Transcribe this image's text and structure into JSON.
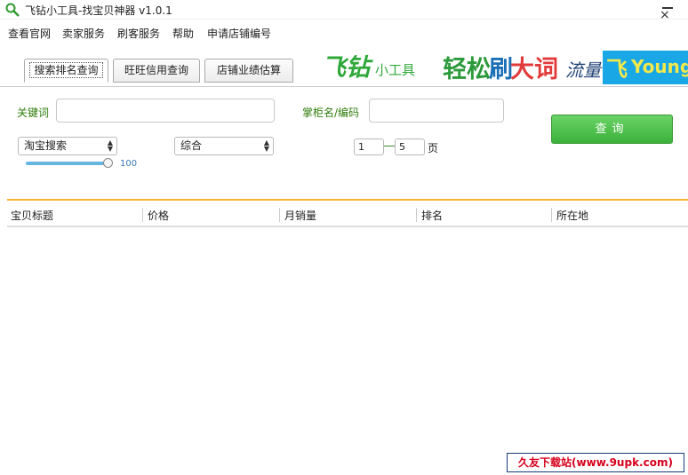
{
  "window": {
    "title": "飞钻小工具-找宝贝神器 v1.0.1",
    "close_glyph": "×"
  },
  "menu": [
    "查看官网",
    "卖家服务",
    "刷客服务",
    "帮助",
    "申请店铺编号"
  ],
  "tabs": [
    "搜索排名查询",
    "旺旺信用查询",
    "店铺业绩估算"
  ],
  "banner": {
    "brand_big": "飞钻",
    "brand_small": "小工具",
    "slogan_green": "轻松",
    "slogan_blue": "刷",
    "slogan_red": "大词",
    "traffic": "流量",
    "logo_letter": "飞",
    "logo_text": "Young"
  },
  "form": {
    "keyword_label": "关键词",
    "keyword_value": "",
    "shopkeeper_label": "掌柜名/编码",
    "shopkeeper_value": "",
    "search_button": "查询",
    "platform_select": "淘宝搜索",
    "sort_select": "综合",
    "slider_value": "100",
    "page_from": "1",
    "page_to": "5",
    "page_unit": "页"
  },
  "table": {
    "columns": [
      "宝贝标题",
      "价格",
      "月销量",
      "排名",
      "所在地"
    ],
    "rows": []
  },
  "watermark": "久友下载站(www.9upk.com)",
  "colors": {
    "accent_green": "#3bb13a",
    "label_green": "#2e7d0a",
    "divider_orange": "#f5b335",
    "slider_blue": "#66b5e0"
  }
}
